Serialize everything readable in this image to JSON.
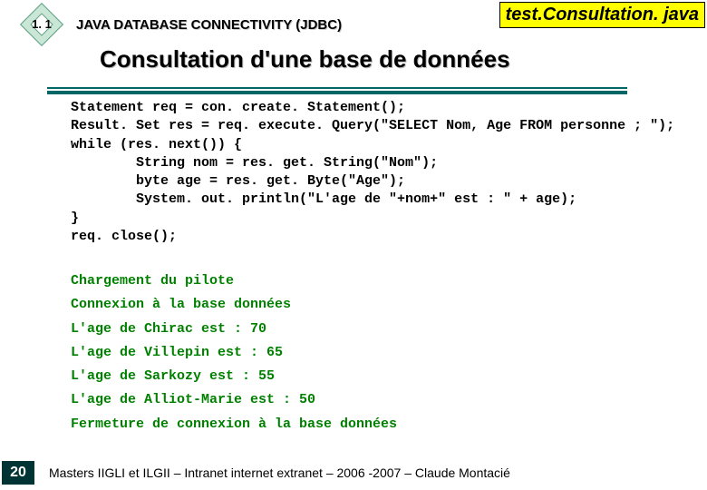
{
  "header": {
    "section_number": "1. 1",
    "breadcrumb": "JAVA DATABASE CONNECTIVITY (JDBC)",
    "file_label": "test.Consultation. java"
  },
  "title": "Consultation d'une base de données",
  "code": "Statement req = con. create. Statement();\nResult. Set res = req. execute. Query(\"SELECT Nom, Age FROM personne ; \");\nwhile (res. next()) {\n        String nom = res. get. String(\"Nom\");\n        byte age = res. get. Byte(\"Age\");\n        System. out. println(\"L'age de \"+nom+\" est : \" + age);\n}\nreq. close();",
  "output_lines": [
    "Chargement du pilote",
    "Connexion à la base données",
    "L'age de Chirac est : 70",
    "L'age de Villepin est : 65",
    "L'age de Sarkozy est : 55",
    "L'age de Alliot-Marie est : 50",
    "Fermeture de connexion à la base données"
  ],
  "footer": {
    "page": "20",
    "text": "Masters IIGLI et ILGII – Intranet internet extranet – 2006 -2007 – Claude Montacié"
  }
}
